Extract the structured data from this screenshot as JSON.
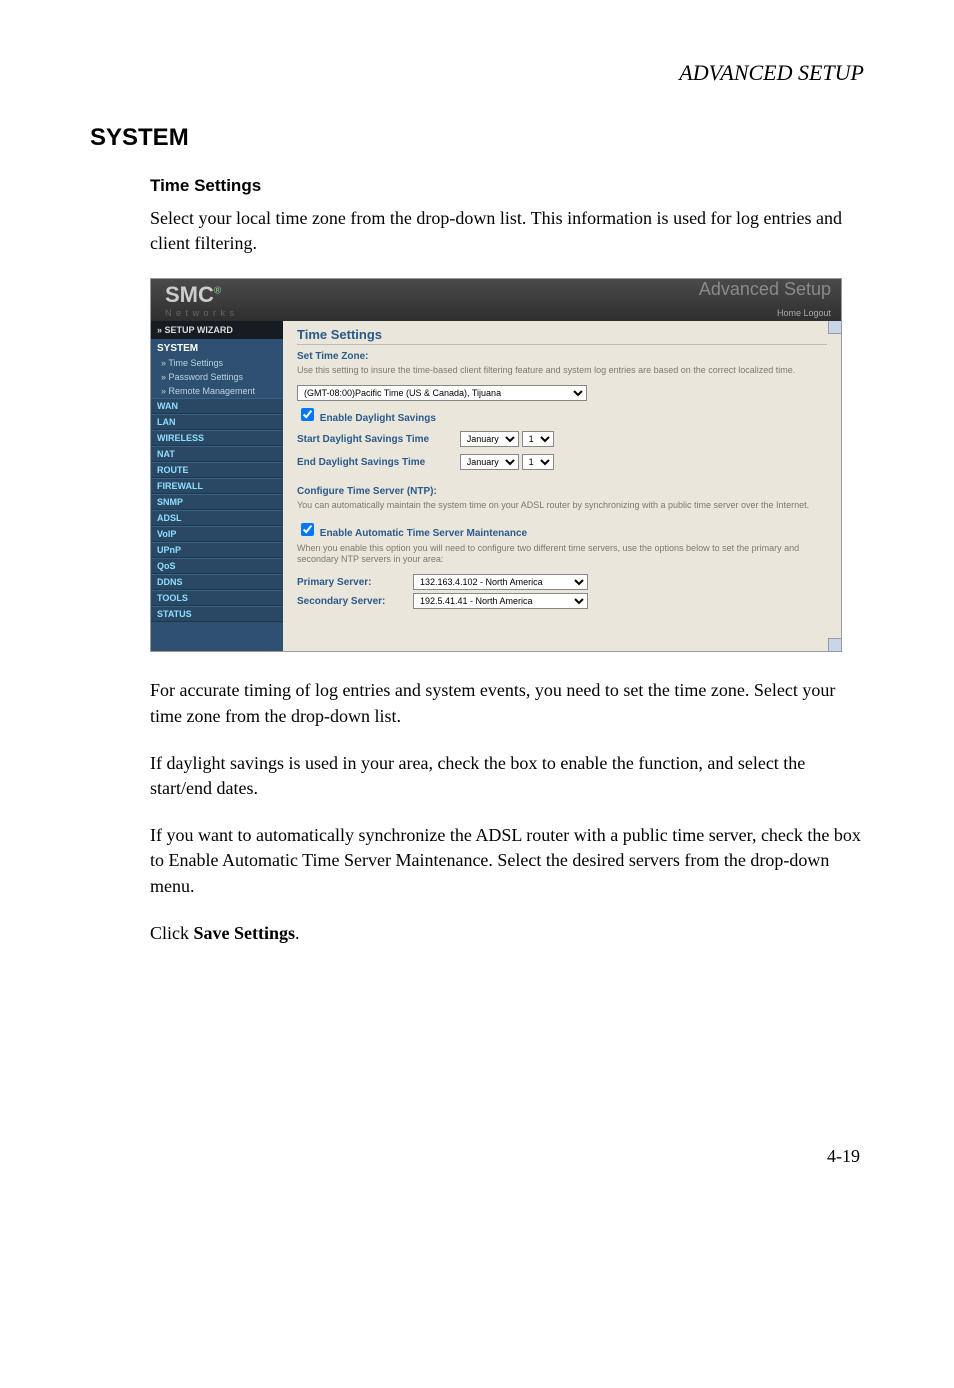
{
  "doc": {
    "chapter_header": "ADVANCED SETUP",
    "section_heading": "SYSTEM",
    "subsection_heading": "Time Settings",
    "intro_para": "Select your local time zone from the drop-down list. This information is used for log entries and client filtering.",
    "para_accurate": "For accurate timing of log entries and system events, you need to set the time zone. Select your time zone from the drop-down list.",
    "para_dst": "If daylight savings is used in your area, check the box to enable the function, and select the start/end dates.",
    "para_ntp": "If you want to automatically synchronize the ADSL router with a public time server, check the box to Enable Automatic Time Server Maintenance. Select the desired servers from the drop-down menu.",
    "para_save_prefix": "Click ",
    "para_save_bold": "Save Settings",
    "para_save_suffix": ".",
    "page_number": "4-19"
  },
  "fig": {
    "header": {
      "logo_main": "SMC",
      "logo_sub": "N e t w o r k s",
      "title": "Advanced Setup",
      "links": "Home   Logout"
    },
    "sidebar": {
      "setup": "» SETUP WIZARD",
      "system": "SYSTEM",
      "system_items": [
        "» Time Settings",
        "» Password Settings",
        "» Remote Management"
      ],
      "cats": [
        "WAN",
        "LAN",
        "WIRELESS",
        "NAT",
        "ROUTE",
        "FIREWALL",
        "SNMP",
        "ADSL",
        "VoIP",
        "UPnP",
        "QoS",
        "DDNS",
        "TOOLS",
        "STATUS"
      ]
    },
    "panel": {
      "title": "Time Settings",
      "set_tz_label": "Set Time Zone:",
      "hint1": "Use this setting to insure the time-based client filtering feature and system log entries are based on the correct localized time.",
      "tz_value": "(GMT-08:00)Pacific Time (US & Canada), Tijuana",
      "enable_dst_label": "Enable Daylight Savings",
      "start_dst_label": "Start Daylight Savings Time",
      "end_dst_label": "End Daylight Savings Time",
      "month_value": "January",
      "day_value": "1",
      "ntp_label": "Configure Time Server (NTP):",
      "ntp_hint": "You can automatically maintain the system time on your ADSL router by synchronizing with a public time server over the Internet.",
      "enable_ntp_label": "Enable Automatic Time Server Maintenance",
      "ntp_hint2": "When you enable this option you will need to configure two different time servers, use the options below to set the primary and secondary NTP servers in your area:",
      "primary_label": "Primary Server:",
      "primary_value": "132.163.4.102 - North America",
      "secondary_label": "Secondary Server:",
      "secondary_value": "192.5.41.41 - North America"
    }
  }
}
